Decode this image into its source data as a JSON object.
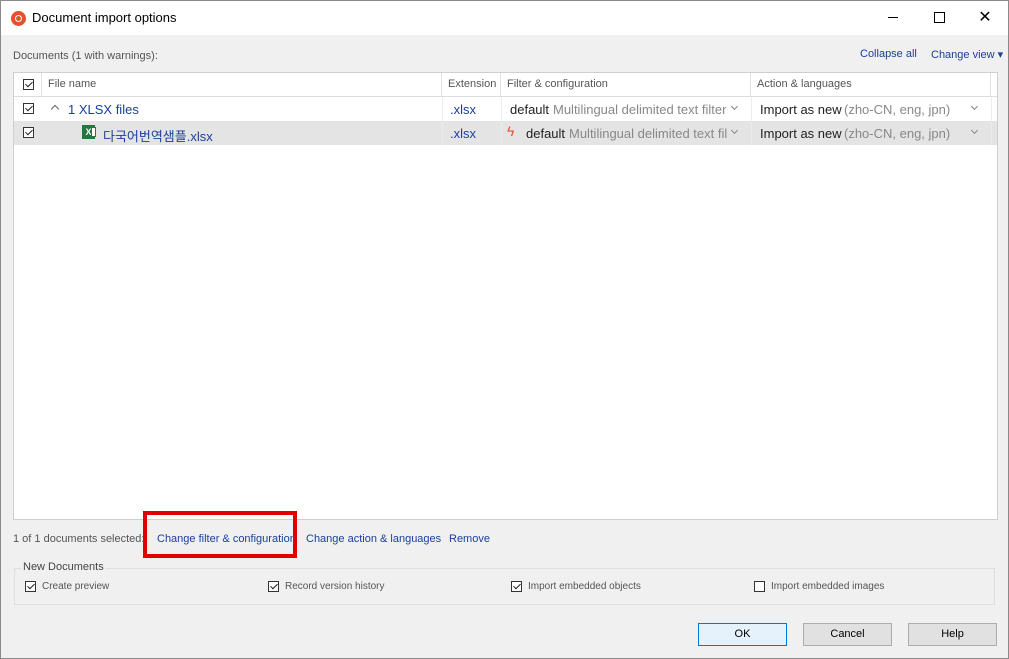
{
  "window": {
    "title": "Document import options"
  },
  "header": {
    "documents_label": "Documents (1 with warnings):",
    "collapse_all": "Collapse all",
    "change_view": "Change view ▾"
  },
  "grid": {
    "columns": [
      "File name",
      "Extension",
      "Filter & configuration",
      "Action & languages"
    ],
    "group_row": {
      "name": "1 XLSX files",
      "extension": ".xlsx",
      "filter_name": "default",
      "filter_desc": "Multilingual delimited text filter",
      "action": "Import as new",
      "languages": "(zho-CN, eng, jpn)"
    },
    "file_row": {
      "name": "다국어번역샘플.xlsx",
      "extension": ".xlsx",
      "filter_name": "default",
      "filter_desc": "Multilingual delimited text fil",
      "action": "Import as new",
      "languages": "(zho-CN, eng, jpn)"
    }
  },
  "selection": {
    "status": "1 of 1 documents selected:",
    "change_filter": "Change filter & configuration",
    "change_action": "Change action & languages",
    "remove": "Remove"
  },
  "new_documents": {
    "title": "New Documents",
    "create_preview": "Create preview",
    "record_version_history": "Record version history",
    "import_embedded_objects": "Import embedded objects",
    "import_embedded_images": "Import embedded images"
  },
  "buttons": {
    "ok": "OK",
    "cancel": "Cancel",
    "help": "Help"
  },
  "colors": {
    "accent": "#1a3f9a",
    "highlight": "#e00000",
    "app_icon": "#e5512b"
  }
}
